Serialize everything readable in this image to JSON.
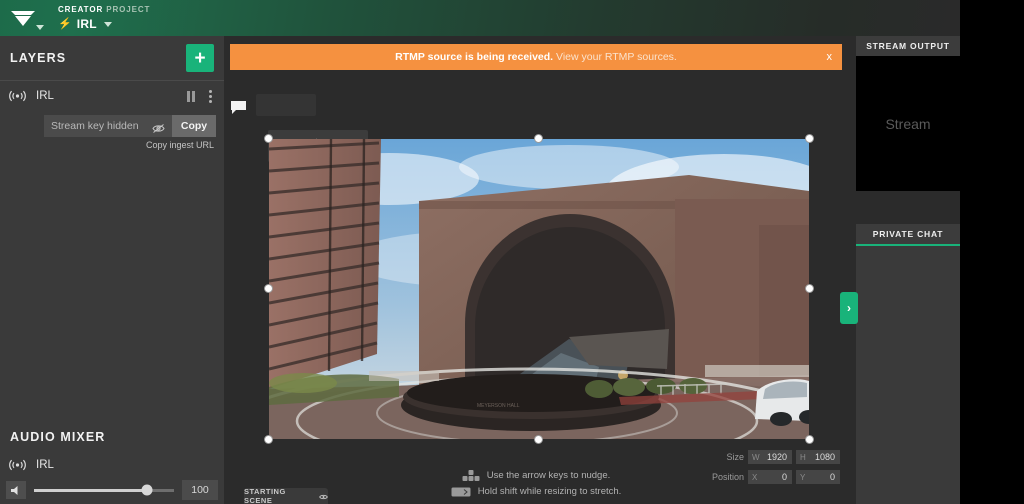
{
  "header": {
    "logo_icon": "lightstream-logo-icon",
    "logo_caret_icon": "chevron-down-icon",
    "creator_label": "CREATOR",
    "project_label": "PROJECT",
    "bolt_icon": "bolt-icon",
    "project_name": "IRL",
    "project_caret_icon": "chevron-down-icon",
    "accent_green": "#19b37a",
    "header_green": "#1d6b4a"
  },
  "sidebar": {
    "layers_title": "LAYERS",
    "add_layer_label": "+",
    "layer": {
      "broadcast_icon": "broadcast-icon",
      "name": "IRL",
      "pause_icon": "pause-icon",
      "menu_icon": "kebab-menu-icon",
      "stream_key_value": "Stream key hidden",
      "eye_icon": "eye-off-icon",
      "copy_label": "Copy",
      "ingest_label": "Copy ingest URL"
    },
    "mixer_title": "AUDIO MIXER",
    "mixer_channel": {
      "broadcast_icon": "broadcast-icon",
      "name": "IRL",
      "speaker_icon": "speaker-icon",
      "volume": "100",
      "volume_percent": 81
    }
  },
  "main": {
    "banner": {
      "message": "RTMP source is being received.",
      "link": "View your RTMP sources.",
      "close_label": "x",
      "color": "#f59140"
    },
    "chat_icon": "chat-bubble-icon",
    "toolbar": [
      {
        "icon": "undo-icon",
        "enabled": false
      },
      {
        "icon": "redo-icon",
        "enabled": false
      },
      {
        "icon": "trash-icon",
        "enabled": true
      },
      {
        "icon": "filters-icon",
        "enabled": true
      }
    ],
    "size": {
      "label": "Size",
      "w_prefix": "W",
      "w": "1920",
      "h_prefix": "H",
      "h": "1080"
    },
    "position": {
      "label": "Position",
      "x_prefix": "X",
      "x": "0",
      "y_prefix": "Y",
      "y": "0"
    },
    "hints": [
      {
        "icon": "arrow-keys-icon",
        "text": "Use the arrow keys to nudge."
      },
      {
        "icon": "shift-key-icon",
        "text": "Hold shift while resizing to stretch."
      }
    ],
    "scene_tab": {
      "label": "STARTING SCENE",
      "icon": "eye-icon"
    }
  },
  "right": {
    "stream_output_title": "STREAM OUTPUT",
    "stream_placeholder": "Stream",
    "private_chat_title": "PRIVATE CHAT",
    "expand_icon": "chevron-right-icon"
  }
}
